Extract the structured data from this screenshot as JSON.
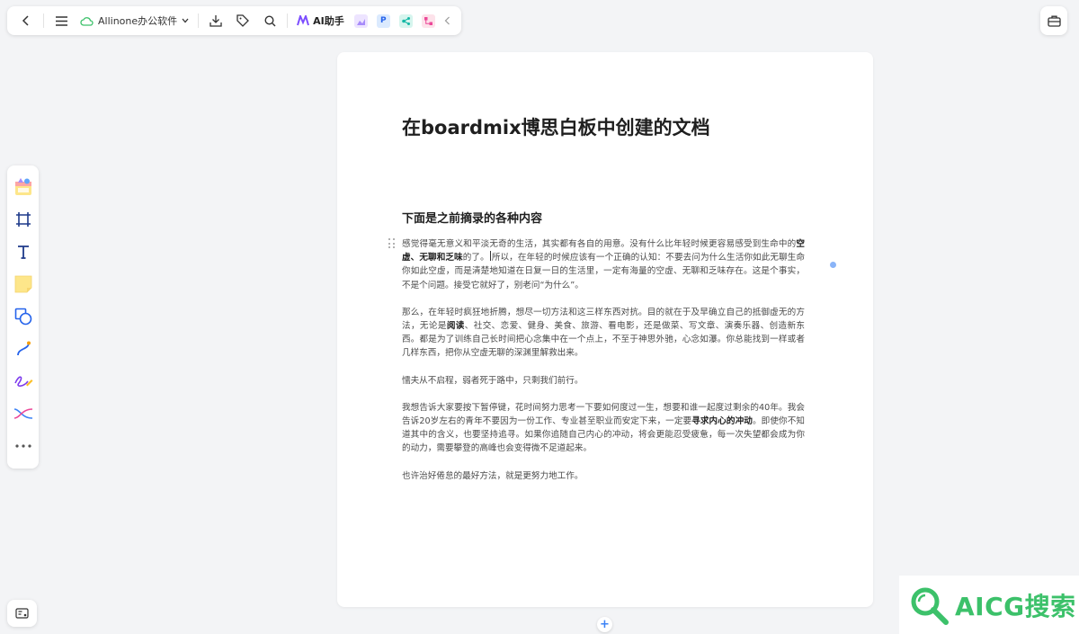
{
  "topbar": {
    "back_icon": "chevron-left-icon",
    "menu_icon": "hamburger-icon",
    "doc_name": "Allinone办公软件",
    "download_icon": "download-icon",
    "tag_icon": "tag-icon",
    "search_icon": "search-icon",
    "ai_label": "AI助手",
    "app_icons": [
      "image-gen-icon",
      "p-app-icon",
      "mindmap-app-icon",
      "flow-app-icon"
    ],
    "collapse_icon": "chevron-left-icon"
  },
  "right_tools": {
    "icon": "toolbox-icon"
  },
  "left_toolbar": {
    "tools": [
      "template-icon",
      "frame-icon",
      "text-icon",
      "sticky-note-icon",
      "shape-icon",
      "connector-icon",
      "pen-icon",
      "ai-magic-icon",
      "more-icon"
    ]
  },
  "document": {
    "title": "在boardmix博思白板中创建的文档",
    "heading": "下面是之前摘录的各种内容",
    "p1_a": "感觉得毫无意义和平淡无奇的生活，其实都有各自的用意。没有什么比年轻时候更容易感受到生命中的",
    "p1_b": "空虚、无聊和乏味",
    "p1_c": "的了。",
    "p1_d": "所以，在年轻的时候应该有一个正确的认知：不要去问为什么生活你如此无聊生命你如此空虚，而是清楚地知道在日复一日的生活里，一定有海量的空虚、无聊和乏味存在。这是个事实，不是个问题。接受它就好了，别老问“为什么”。",
    "p2_a": "那么，在年轻时疯狂地折腾，想尽一切方法和这三样东西对抗。目的就在于及早确立自己的抵御虚无的方法，无论是",
    "p2_b": "阅读",
    "p2_c": "、社交、恋爱、健身、美食、旅游、看电影，还是做菜、写文章、演奏乐器、创造新东西。都是为了训练自己长时间把心念集中在一个点上，不至于神思外驰，心念如瀑。你总能找到一样或者几样东西，把你从空虚无聊的深渊里解救出来。",
    "p3": "懦夫从不启程，弱者死于路中，只剩我们前行。",
    "p4_a": "我想告诉大家要按下暂停键，花时间努力思考一下要如何度过一生，想要和谁一起度过剩余的40年。我会告诉20岁左右的青年不要因为一份工作、专业甚至职业而安定下来，一定要",
    "p4_b": "寻求内心的冲动",
    "p4_c": "。即使你不知道其中的含义，也要坚持追寻。如果你追随自己内心的冲动，将会更能忍受疲惫，每一次失望都会成为你的动力，需要攀登的高峰也会变得微不足道起来。",
    "p5": "也许治好倦怠的最好方法，就是更努力地工作。"
  },
  "bottom": {
    "panel_icon": "layers-panel-icon",
    "add_page": "+"
  },
  "watermark": {
    "text": "AICG搜索"
  },
  "colors": {
    "accent": "#3b82f6",
    "watermark": "#3cc16a"
  }
}
